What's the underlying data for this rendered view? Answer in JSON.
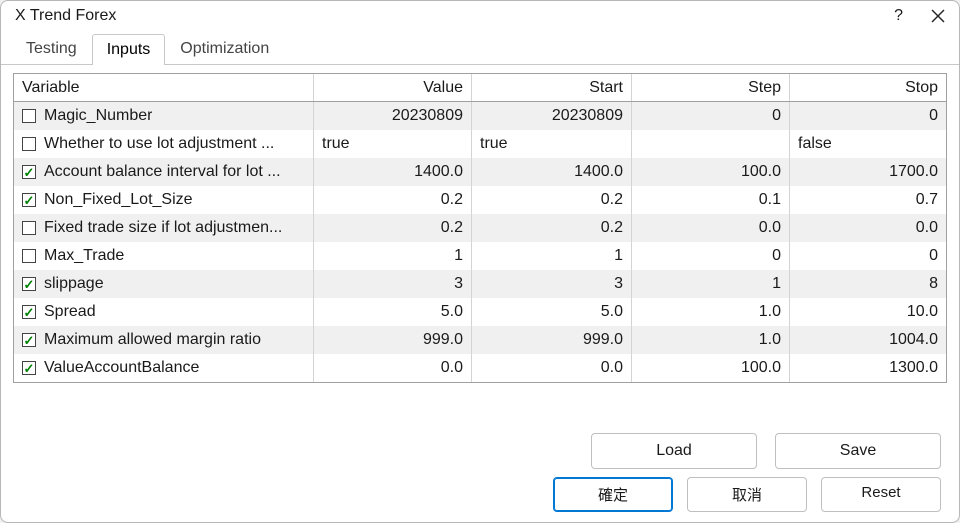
{
  "window": {
    "title": "X Trend Forex"
  },
  "tabs": {
    "testing": "Testing",
    "inputs": "Inputs",
    "optimization": "Optimization",
    "active": "inputs"
  },
  "headers": {
    "variable": "Variable",
    "value": "Value",
    "start": "Start",
    "step": "Step",
    "stop": "Stop"
  },
  "rows": [
    {
      "checked": false,
      "variable": "Magic_Number",
      "value": "20230809",
      "start": "20230809",
      "step": "0",
      "stop": "0",
      "textual": false
    },
    {
      "checked": false,
      "variable": "Whether to use lot adjustment ...",
      "value": "true",
      "start": "true",
      "step": "",
      "stop": "false",
      "textual": true
    },
    {
      "checked": true,
      "variable": "Account balance interval for lot ...",
      "value": "1400.0",
      "start": "1400.0",
      "step": "100.0",
      "stop": "1700.0",
      "textual": false
    },
    {
      "checked": true,
      "variable": "Non_Fixed_Lot_Size",
      "value": "0.2",
      "start": "0.2",
      "step": "0.1",
      "stop": "0.7",
      "textual": false
    },
    {
      "checked": false,
      "variable": "Fixed trade size if lot adjustmen...",
      "value": "0.2",
      "start": "0.2",
      "step": "0.0",
      "stop": "0.0",
      "textual": false
    },
    {
      "checked": false,
      "variable": "Max_Trade",
      "value": "1",
      "start": "1",
      "step": "0",
      "stop": "0",
      "textual": false
    },
    {
      "checked": true,
      "variable": "slippage",
      "value": "3",
      "start": "3",
      "step": "1",
      "stop": "8",
      "textual": false
    },
    {
      "checked": true,
      "variable": "Spread",
      "value": "5.0",
      "start": "5.0",
      "step": "1.0",
      "stop": "10.0",
      "textual": false
    },
    {
      "checked": true,
      "variable": "Maximum allowed margin ratio",
      "value": "999.0",
      "start": "999.0",
      "step": "1.0",
      "stop": "1004.0",
      "textual": false
    },
    {
      "checked": true,
      "variable": "ValueAccountBalance",
      "value": "0.0",
      "start": "0.0",
      "step": "100.0",
      "stop": "1300.0",
      "textual": false
    }
  ],
  "buttons": {
    "load": "Load",
    "save": "Save",
    "ok": "確定",
    "cancel": "取消",
    "reset": "Reset"
  }
}
